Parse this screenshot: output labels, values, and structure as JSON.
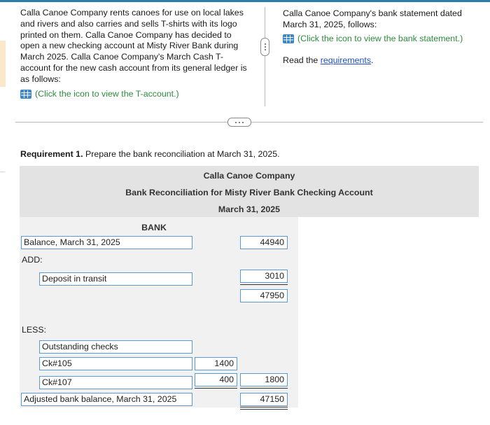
{
  "intro": {
    "text": "Calla Canoe Company rents canoes for use on local lakes and rivers and also carries and sells T-shirts with its logo printed on them. Calla Canoe Company has decided to open a new checking account at Misty River Bank during March 2025. Calla Canoe Company's March Cash T-account for the new cash account from its general ledger is as follows:",
    "link": "(Click the icon to view the T-account.)",
    "link_icon": "table-grid-icon"
  },
  "right": {
    "text": "Calla Canoe Company's bank statement dated March 31, 2025, follows:",
    "link": "(Click the icon to view the bank statement.)",
    "link_icon": "table-grid-icon",
    "read_prefix": "Read the ",
    "req_link": "requirements",
    "read_suffix": "."
  },
  "requirement": {
    "bold": "Requirement 1.",
    "text": " Prepare the bank reconciliation at March 31, 2025."
  },
  "reconciliation": {
    "company": "Calla Canoe Company",
    "title": "Bank Reconciliation for Misty River Bank Checking Account",
    "date": "March 31, 2025",
    "column": "BANK",
    "balance_label": "Balance, March 31, 2025",
    "balance_value": "44940",
    "add_label": "ADD:",
    "deposit_label": "Deposit in transit",
    "deposit_value": "3010",
    "subtotal_value": "47950",
    "less_label": "LESS:",
    "outstanding_label": "Outstanding checks",
    "ck1_label": "Ck#105",
    "ck1_value": "1400",
    "ck2_label": "Ck#107",
    "ck2_value": "400",
    "checks_total": "1800",
    "adjusted_label": "Adjusted bank balance, March 31, 2025",
    "adjusted_value": "47150"
  },
  "colors": {
    "accent_rule": "#2a7fa8",
    "link_green": "#2e8b3d",
    "link_blue": "#1f4fbf",
    "input_border": "#5b9bd5",
    "header_bg": "#e3e3e3",
    "body_bg": "#f1f1f1"
  }
}
